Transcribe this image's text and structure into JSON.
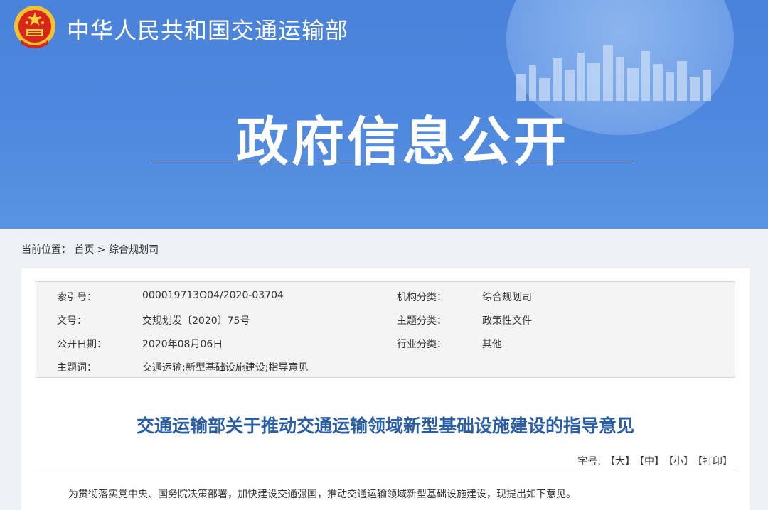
{
  "header": {
    "ministry_name": "中华人民共和国交通运输部",
    "banner_title": "政府信息公开",
    "colors": {
      "banner": "#4f88de",
      "title_blue": "#2a5fa8"
    }
  },
  "breadcrumb": {
    "prefix": "当前位置：",
    "home": "首页",
    "separator": ">",
    "current": "综合规划司"
  },
  "metadata": {
    "rows": [
      {
        "label": "索引号：",
        "value": "000019713O04/2020-03704"
      },
      {
        "label": "机构分类：",
        "value": "综合规划司"
      },
      {
        "label": "文号：",
        "value": "交规划发〔2020〕75号"
      },
      {
        "label": "主题分类：",
        "value": "政策性文件"
      },
      {
        "label": "公开日期：",
        "value": "2020年08月06日"
      },
      {
        "label": "行业分类：",
        "value": "其他"
      },
      {
        "label": "主题词：",
        "value": "交通运输;新型基础设施建设;指导意见"
      }
    ]
  },
  "article": {
    "title": "交通运输部关于推动交通运输领域新型基础设施建设的指导意见",
    "font_size_label": "字号:",
    "font_large": "【大】",
    "font_medium": "【中】",
    "font_small": "【小】",
    "print": "【打印】",
    "first_paragraph": "为贯彻落实党中央、国务院决策部署，加快建设交通强国，推动交通运输领域新型基础设施建设，现提出如下意见。"
  }
}
